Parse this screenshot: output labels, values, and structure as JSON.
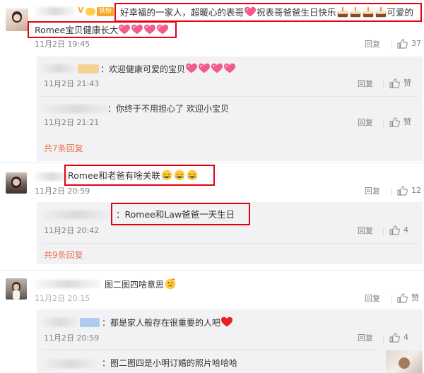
{
  "comments": [
    {
      "text_line1": "好幸福的一家人，超暖心的表哥",
      "text_line1_b": "祝表哥爸爸生日快乐",
      "text_line1_c": "可爱的",
      "text_line2": "Romee宝贝健康长大",
      "time": "11月2日 19:45",
      "reply": "回复",
      "likes": "37",
      "badge": "铁粉",
      "replies": [
        {
          "text": "：欢迎健康可爱的宝贝",
          "time": "11月2日 21:43",
          "reply": "回复",
          "likes": "赞"
        },
        {
          "text": "：你终于不用担心了 欢迎小宝贝",
          "time": "11月2日 21:21",
          "reply": "回复",
          "likes": "赞"
        }
      ],
      "more": "共7条回复"
    },
    {
      "text": "Romee和老爸有啥关联",
      "time": "11月2日 20:59",
      "reply": "回复",
      "likes": "12",
      "replies": [
        {
          "text": "：Romee和Law爸爸一天生日",
          "time": "11月2日 20:42",
          "reply": "回复",
          "likes": "4"
        }
      ],
      "more": "共9条回复"
    },
    {
      "text": "图二图四啥意思",
      "time": "11月2日 20:15",
      "reply": "回复",
      "likes": "赞",
      "replies": [
        {
          "text": "：都是家人般存在很重要的人吧",
          "time": "11月2日 20:59",
          "reply": "回复",
          "likes": "4"
        },
        {
          "text": "：图二图四是小明订婚的照片哈哈哈"
        }
      ]
    }
  ],
  "colors": {
    "accent": "#eb7350",
    "highlight": "#e60012",
    "reply_bg": "#f2f2f5",
    "badge": "#f5a623"
  },
  "icons": [
    "thumbs-up-icon",
    "heart-emoji",
    "cake-emoji",
    "face-emoji",
    "thinking-emoji",
    "red-heart-emoji"
  ]
}
